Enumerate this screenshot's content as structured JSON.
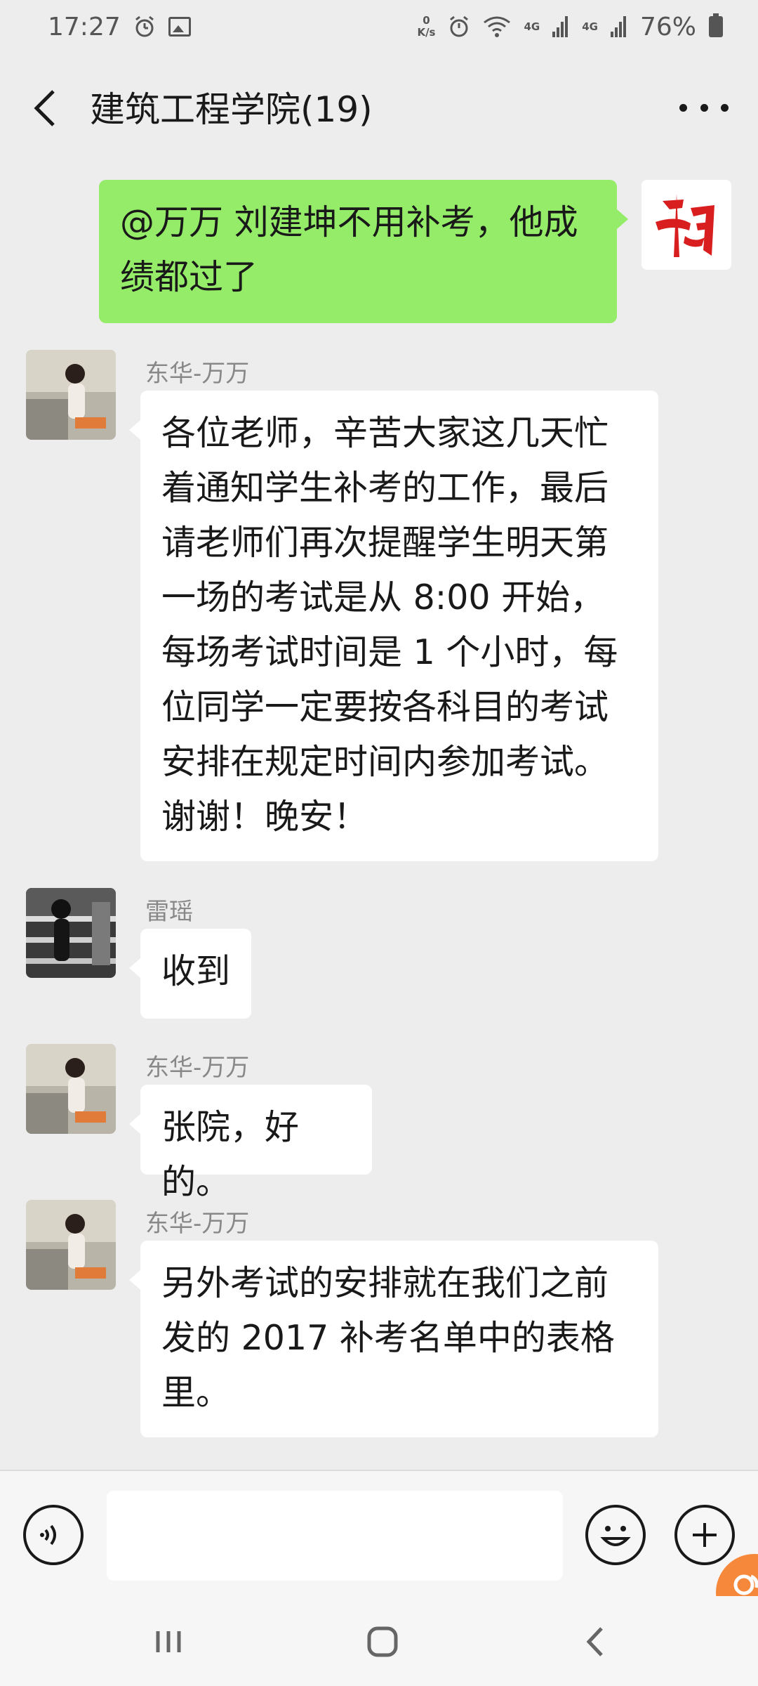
{
  "status_bar": {
    "time": "17:27",
    "net_speed_value": "0",
    "net_speed_unit": "K/s",
    "signal1": "4G",
    "signal2": "4G",
    "battery": "76%",
    "icons": [
      "alarm-icon",
      "image-icon",
      "alarm-icon",
      "wifi-icon",
      "signal-icon",
      "signal-icon",
      "battery-icon"
    ]
  },
  "header": {
    "title": "建筑工程学院(19)",
    "back_icon": "chevron-left-icon",
    "more_icon": "more-dots-icon"
  },
  "messages": [
    {
      "direction": "out",
      "sender": "",
      "text": "@万万  刘建坤不用补考，他成绩都过了",
      "avatar_icon": "calligraphy-avatar"
    },
    {
      "direction": "in",
      "sender": "东华-万万",
      "text": "各位老师，辛苦大家这几天忙着通知学生补考的工作，最后请老师们再次提醒学生明天第一场的考试是从 8:00 开始，每场考试时间是 1 个小时，每位同学一定要按各科目的考试安排在规定时间内参加考试。谢谢！晚安！",
      "avatar_icon": "photo-avatar"
    },
    {
      "direction": "in",
      "sender": "雷瑶",
      "text": "收到",
      "avatar_icon": "photo-avatar-bw"
    },
    {
      "direction": "in",
      "sender": "东华-万万",
      "text": "张院，好的。",
      "avatar_icon": "photo-avatar"
    },
    {
      "direction": "in",
      "sender": "东华-万万",
      "text": "另外考试的安排就在我们之前发的 2017 补考名单中的表格里。",
      "avatar_icon": "photo-avatar"
    }
  ],
  "input_bar": {
    "voice_icon": "voice-icon",
    "emoji_icon": "emoji-icon",
    "plus_icon": "plus-icon",
    "input_value": ""
  },
  "nav_bar": {
    "recents_icon": "recents-icon",
    "home_icon": "home-icon",
    "back_icon": "back-icon"
  },
  "colors": {
    "background": "#ededed",
    "outgoing_bubble": "#95ec69",
    "incoming_bubble": "#ffffff",
    "sender_name": "#888888"
  }
}
